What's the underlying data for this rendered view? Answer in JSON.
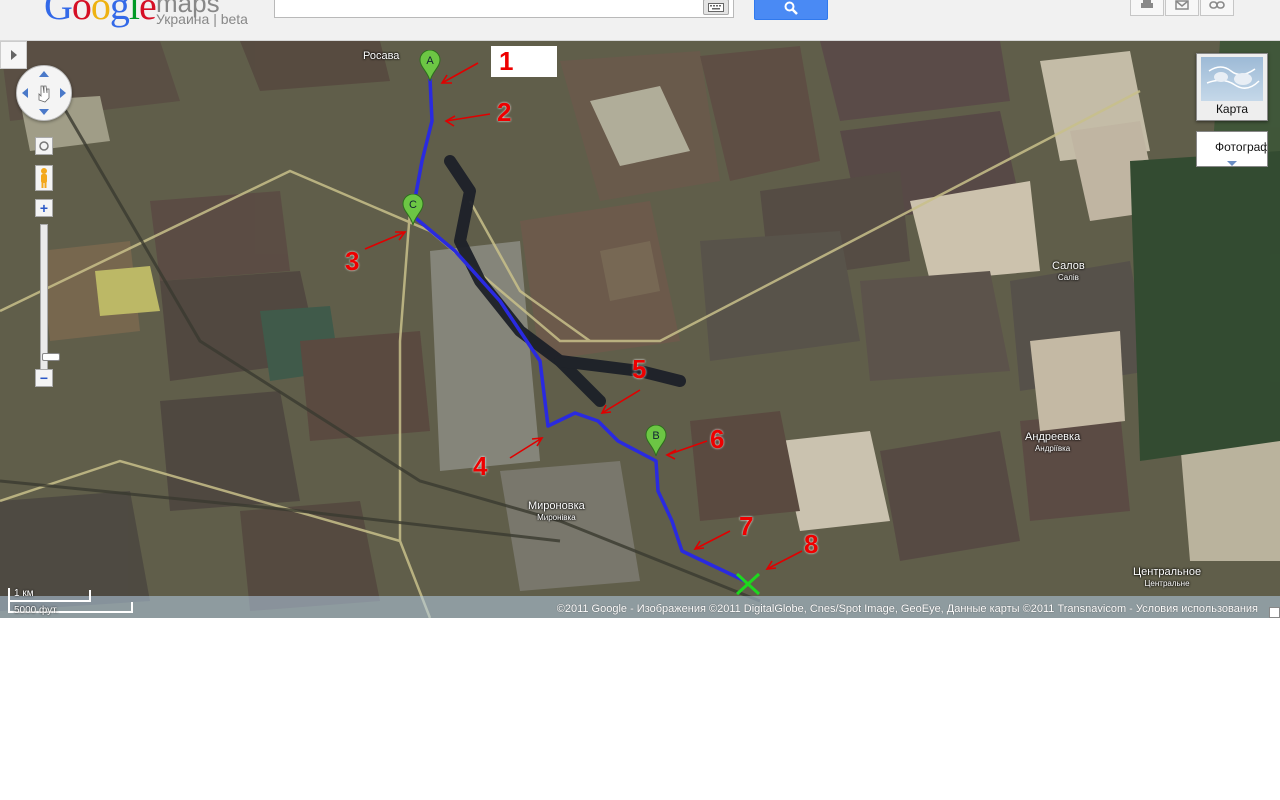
{
  "header": {
    "logo_google": "Google",
    "logo_maps": "maps",
    "logo_subtitle": "Украина | beta",
    "search": {
      "value": "",
      "placeholder": ""
    },
    "search_button_icon": "magnifier-icon",
    "keyboard_icon": "keyboard-icon",
    "tools": [
      {
        "name": "print",
        "icon": "printer-icon"
      },
      {
        "name": "email",
        "icon": "envelope-icon"
      },
      {
        "name": "link",
        "icon": "link-icon"
      }
    ]
  },
  "map": {
    "type_thumb_label": "Карта",
    "type_selected_label": "Фотограф",
    "scale": {
      "metric": "1 км",
      "imperial": "5000 фут."
    },
    "copyright": "©2011 Google - Изображения ©2011 DigitalGlobe, Cnes/Spot Image, GeoEye, Данные карты ©2011 Transnavicom - Условия использования",
    "places": [
      {
        "name": "Росава",
        "sub": ""
      },
      {
        "name": "Миронoвка",
        "sub": "Миронівка"
      },
      {
        "name": "Салов",
        "sub": "Салів"
      },
      {
        "name": "Андреевка",
        "sub": "Андріївка"
      },
      {
        "name": "Центральное",
        "sub": "Центральне"
      }
    ],
    "markers": [
      {
        "label": "A",
        "color": "#6cc644"
      },
      {
        "label": "C",
        "color": "#6cc644"
      },
      {
        "label": "B",
        "color": "#6cc644"
      }
    ],
    "annotations": [
      "1",
      "2",
      "3",
      "4",
      "5",
      "6",
      "7",
      "8"
    ],
    "route_color": "#2a2ae0",
    "annotation_color": "#e00000"
  }
}
